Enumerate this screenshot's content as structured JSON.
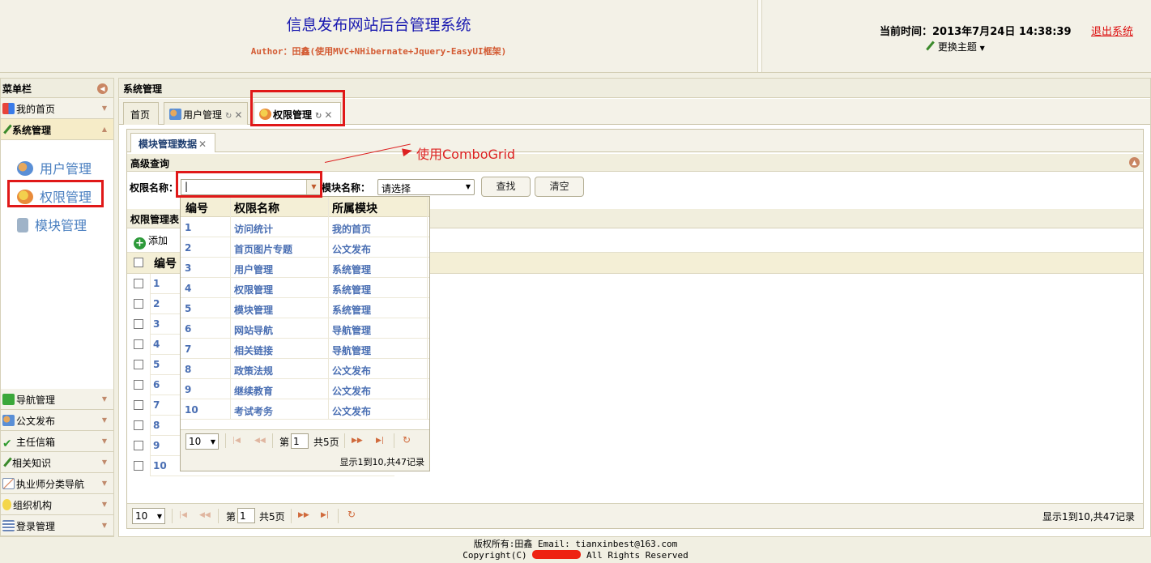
{
  "header": {
    "title": "信息发布网站后台管理系统",
    "author": "Author：田鑫(使用MVC+NHibernate+Jquery-EasyUI框架)",
    "time_label": "当前时间：2013年7月24日  14:38:39",
    "logout": "退出系统",
    "theme": "更换主题"
  },
  "sidebar": {
    "title": "菜单栏",
    "home": "我的首页",
    "system": "系统管理",
    "subitems": [
      "用户管理",
      "权限管理",
      "模块管理"
    ],
    "bottom": [
      "导航管理",
      "公文发布",
      "主任信箱",
      "相关知识",
      "执业师分类导航",
      "组织机构",
      "登录管理"
    ]
  },
  "main": {
    "title": "系统管理",
    "tabs": [
      "首页",
      "用户管理",
      "权限管理"
    ],
    "inner_tab": "模块管理数据",
    "search": {
      "title": "高级查询",
      "perm_label": "权限名称：",
      "perm_value": "|",
      "module_label": "模块名称：",
      "module_value": "请选择",
      "find": "查找",
      "clear": "清空"
    },
    "grid": {
      "title": "权限管理表",
      "add": "添加",
      "col_id": "编号",
      "ids": [
        "1",
        "2",
        "3",
        "4",
        "5",
        "6",
        "7",
        "8",
        "9",
        "10"
      ]
    },
    "pager": {
      "size": "10",
      "page_prefix": "第",
      "page": "1",
      "page_suffix": "共5页",
      "info": "显示1到10,共47记录"
    }
  },
  "combogrid": {
    "annotation": "使用ComboGrid",
    "headers": [
      "编号",
      "权限名称",
      "所属模块"
    ],
    "rows": [
      [
        "1",
        "访问统计",
        "我的首页"
      ],
      [
        "2",
        "首页图片专题",
        "公文发布"
      ],
      [
        "3",
        "用户管理",
        "系统管理"
      ],
      [
        "4",
        "权限管理",
        "系统管理"
      ],
      [
        "5",
        "模块管理",
        "系统管理"
      ],
      [
        "6",
        "网站导航",
        "导航管理"
      ],
      [
        "7",
        "相关链接",
        "导航管理"
      ],
      [
        "8",
        "政策法规",
        "公文发布"
      ],
      [
        "9",
        "继续教育",
        "公文发布"
      ],
      [
        "10",
        "考试考务",
        "公文发布"
      ]
    ],
    "pager": {
      "size": "10",
      "page_prefix": "第",
      "page": "1",
      "page_suffix": "共5页",
      "info": "显示1到10,共47记录"
    }
  },
  "footer": {
    "line1": "版权所有:田鑫 Email: tianxinbest@163.com",
    "line2_prefix": "Copyright(C)",
    "line2_suffix": "All Rights Reserved"
  },
  "colors": {
    "highlight": "#e01818",
    "title_blue": "#1a1ab0",
    "link_blue": "#4a7fc0"
  }
}
